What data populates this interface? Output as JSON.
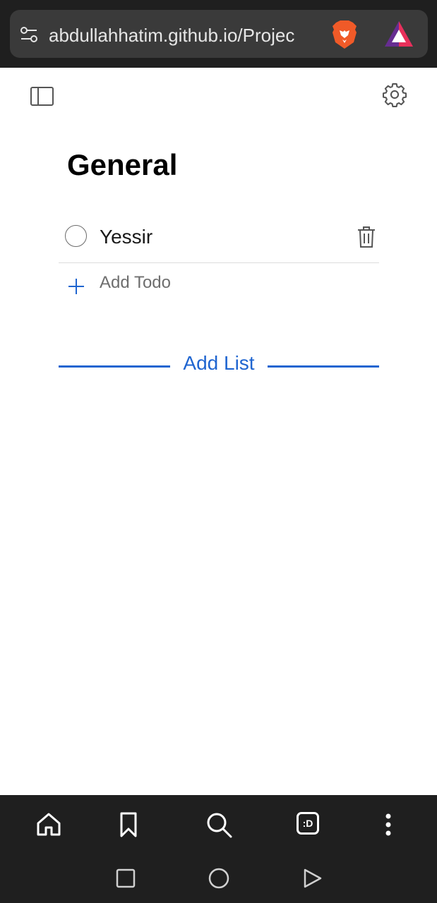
{
  "browser": {
    "url": "abdullahhatim.github.io/Projec",
    "icons": {
      "site_settings": "site-settings-icon",
      "brave": "brave-shields-icon",
      "rewards": "brave-rewards-icon"
    }
  },
  "app": {
    "header_icons": {
      "sidebar_toggle": "sidebar-toggle-icon",
      "settings": "gear-icon"
    },
    "list": {
      "title": "General",
      "todos": [
        {
          "text": "Yessir",
          "completed": false
        }
      ],
      "add_todo_placeholder": "Add Todo"
    },
    "add_list_label": "Add List",
    "accent_color": "#1f65d0"
  },
  "bottom_toolbar": {
    "items": [
      "home-icon",
      "bookmark-icon",
      "search-icon",
      "tabs-icon",
      "more-icon"
    ],
    "tabs_label": ":D"
  },
  "system_nav": [
    "recents-icon",
    "home-circle-icon",
    "back-icon"
  ]
}
